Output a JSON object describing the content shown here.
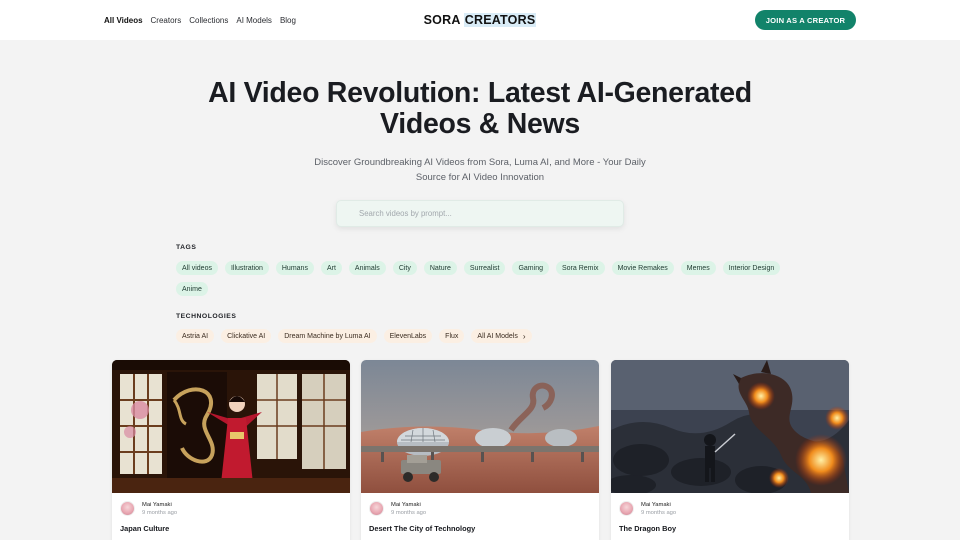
{
  "nav": {
    "items": [
      {
        "label": "All Videos",
        "active": true
      },
      {
        "label": "Creators",
        "active": false
      },
      {
        "label": "Collections",
        "active": false
      },
      {
        "label": "AI Models",
        "active": false
      },
      {
        "label": "Blog",
        "active": false
      }
    ],
    "logo_part1": "SORA ",
    "logo_part2": "CREATORS",
    "join_label": "JOIN AS A CREATOR"
  },
  "hero": {
    "title": "AI Video Revolution: Latest AI-Generated Videos & News",
    "subtitle": "Discover Groundbreaking AI Videos from Sora, Luma AI, and More - Your Daily Source for AI Video Innovation"
  },
  "search": {
    "placeholder": "Search videos by prompt..."
  },
  "tags": {
    "label": "TAGS",
    "items": [
      "All videos",
      "Illustration",
      "Humans",
      "Art",
      "Animals",
      "City",
      "Nature",
      "Surrealist",
      "Gaming",
      "Sora Remix",
      "Movie Remakes",
      "Memes",
      "Interior Design",
      "Anime"
    ]
  },
  "technologies": {
    "label": "TECHNOLOGIES",
    "items": [
      "Astria AI",
      "Clickative AI",
      "Dream Machine by Luma AI",
      "ElevenLabs",
      "Flux"
    ],
    "more_label": "All AI Models",
    "more_icon": "chevron-right-icon"
  },
  "cards": [
    {
      "creator": "Mai Yamaki",
      "time": "9 months ago",
      "title": "Japan Culture"
    },
    {
      "creator": "Mai Yamaki",
      "time": "9 months ago",
      "title": "Desert The City of Technology"
    },
    {
      "creator": "Mai Yamaki",
      "time": "9 months ago",
      "title": "The Dragon Boy"
    }
  ],
  "colors": {
    "accent": "#12836a",
    "tag_bg": "#dcf3e7",
    "tech_bg": "#fbefe3",
    "page_bg": "#f3f3f3"
  }
}
